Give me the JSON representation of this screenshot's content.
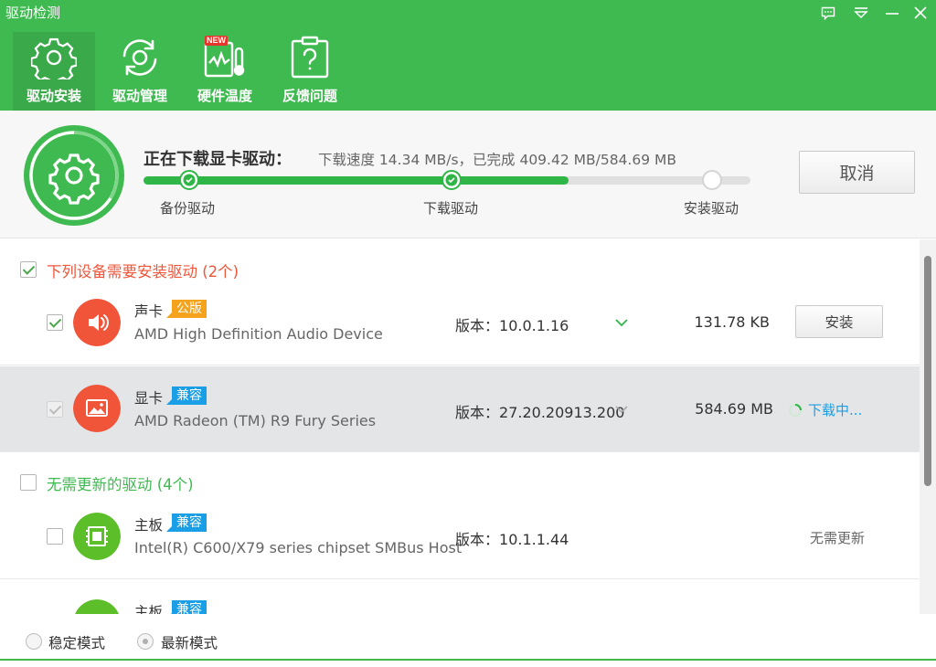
{
  "window": {
    "title": "驱动检测",
    "controls": [
      "feedback-icon",
      "menu-icon",
      "minimize-icon",
      "close-icon"
    ]
  },
  "nav": {
    "items": [
      {
        "label": "驱动安装",
        "icon": "gear-icon",
        "active": true
      },
      {
        "label": "驱动管理",
        "icon": "refresh-gear-icon",
        "active": false
      },
      {
        "label": "硬件温度",
        "icon": "thermometer-icon",
        "active": false,
        "badge": "NEW"
      },
      {
        "label": "反馈问题",
        "icon": "question-clipboard-icon",
        "active": false
      }
    ]
  },
  "progress": {
    "title": "正在下载显卡驱动：",
    "detail": "下载速度 14.34 MB/s，已完成 409.42 MB/584.69 MB",
    "fraction": 0.7,
    "steps": [
      "备份驱动",
      "下载驱动",
      "安装驱动"
    ],
    "cancel_label": "取消"
  },
  "groups": [
    {
      "title": "下列设备需要安装驱动 (2个)",
      "color": "#f0553a",
      "checked": true,
      "devices": [
        {
          "type": "声卡",
          "tag": "公版",
          "tag_color": "orange",
          "name": "AMD High Definition Audio Device",
          "version_label": "版本：",
          "version": "10.0.1.16",
          "size": "131.78 KB",
          "action": "安装",
          "icon": "speaker-icon",
          "icon_color": "#f0553a"
        },
        {
          "type": "显卡",
          "tag": "兼容",
          "tag_color": "blue",
          "name": "AMD Radeon (TM) R9 Fury Series",
          "version_label": "版本：",
          "version": "27.20.20913.200",
          "size": "584.69 MB",
          "action": "下载中...",
          "icon": "display-icon",
          "icon_color": "#f0553a"
        }
      ]
    },
    {
      "title": "无需更新的驱动 (4个)",
      "color": "#3fba50",
      "checked": false,
      "devices": [
        {
          "type": "主板",
          "tag": "兼容",
          "tag_color": "blue",
          "name": "Intel(R) C600/X79 series chipset SMBus Host",
          "version_label": "版本：",
          "version": "10.1.1.44",
          "status": "无需更新",
          "icon": "chip-icon",
          "icon_color": "#5cbf2a"
        },
        {
          "type": "主板",
          "tag": "兼容",
          "tag_color": "blue",
          "icon": "chip-icon",
          "icon_color": "#5cbf2a"
        }
      ]
    }
  ],
  "footer": {
    "modes": [
      {
        "label": "稳定模式",
        "selected": false
      },
      {
        "label": "最新模式",
        "selected": true
      }
    ]
  }
}
